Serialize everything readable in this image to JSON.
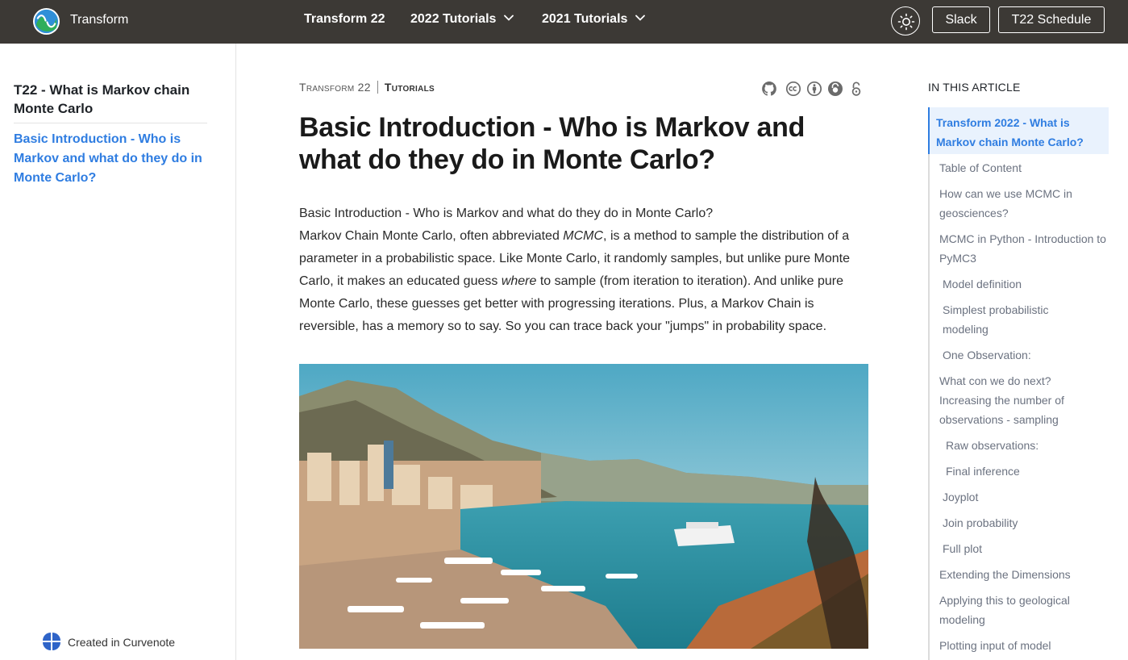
{
  "topbar": {
    "brand": "Transform",
    "nav": [
      "Transform 22",
      "2022 Tutorials",
      "2021 Tutorials"
    ],
    "buttons": {
      "slack": "Slack",
      "schedule": "T22 Schedule"
    }
  },
  "sidebar": {
    "title": "T22 - What is Markov chain Monte Carlo",
    "link": "Basic Introduction - Who is Markov and what do they do in Monte Carlo?",
    "footer": "Created in Curvenote"
  },
  "breadcrumb": {
    "venue": "Transform 22",
    "section": "Tutorials"
  },
  "article": {
    "title": "Basic Introduction - Who is Markov and what do they do in Monte Carlo?",
    "lead": "Basic Introduction - Who is Markov and what do they do in Monte Carlo?",
    "p1a": "Markov Chain Monte Carlo, often abbreviated ",
    "p1em": "MCMC",
    "p1b": ", is a method to sample the distribution of a parameter in a probabilistic space. Like Monte Carlo, it randomly samples, but unlike pure Monte Carlo, it makes an educated guess ",
    "p1em2": "where",
    "p1c": " to sample (from iteration to iteration). And unlike pure Monte Carlo, these guesses get better with progressing iterations. Plus, a Markov Chain is reversible, has a memory so to say. So you can trace back your \"jumps\" in probability space."
  },
  "toc": {
    "heading": "In this article",
    "items": [
      "Transform 2022 - What is Markov chain Monte Carlo?",
      "Table of Content",
      "How can we use MCMC in geosciences?",
      "MCMC in Python - Introduction to PyMC3",
      "Model definition",
      "Simplest probabilistic modeling",
      "One Observation:",
      "What con we do next? Increasing the number of observations - sampling",
      "Raw observations:",
      "Final inference",
      "Joyplot",
      "Join probability",
      "Full plot",
      "Extending the Dimensions",
      "Applying this to geological modeling",
      "Plotting input of model"
    ]
  },
  "icons": {
    "logo": "transform-logo-icon",
    "nav_chevron": "chevron-down-icon",
    "theme": "sun-icon",
    "meta": [
      "github-icon",
      "cc-icon",
      "by-icon",
      "open-access-icon",
      "lock-icon"
    ],
    "curvenote": "curvenote-logo-icon"
  },
  "colors": {
    "topbar": "#3c3935",
    "link": "#2f7de1",
    "toc_active_bg": "#e9f2fd"
  }
}
